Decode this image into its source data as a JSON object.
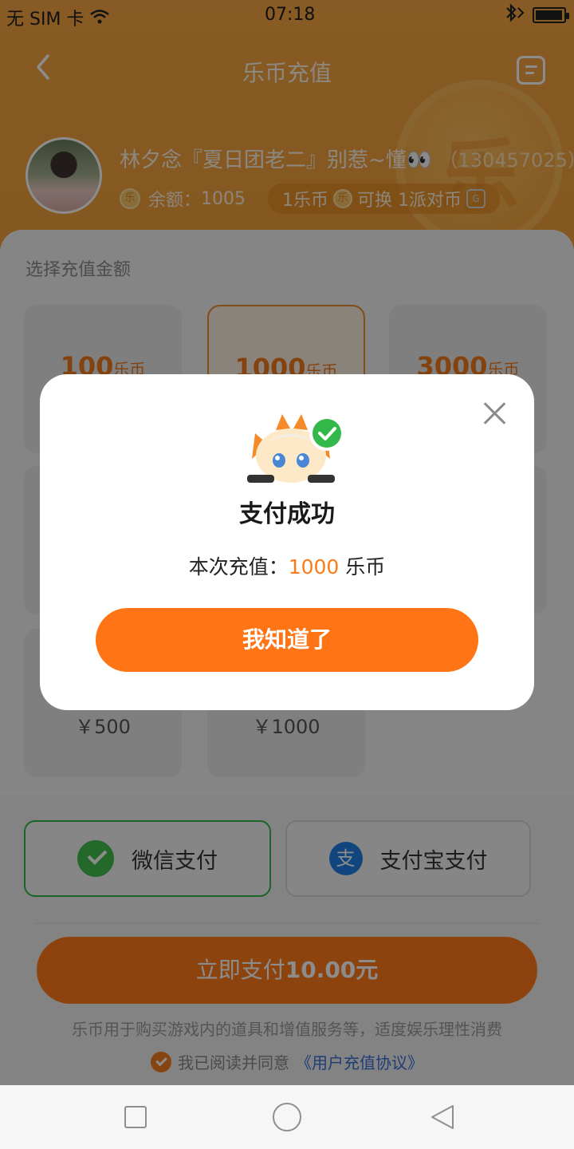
{
  "status_bar": {
    "carrier": "无 SIM 卡",
    "time": "07:18"
  },
  "nav": {
    "title": "乐币充值"
  },
  "user": {
    "name": "林夕念『夏日团老二』别惹~懂👀",
    "id": "（130457025）",
    "balance_label": "余额：",
    "balance": "1005",
    "rate_part1": "1乐币",
    "rate_part2": "可换 1派对币"
  },
  "recharge": {
    "section_title": "选择充值金额",
    "unit": "乐币",
    "options": [
      {
        "amount": "100",
        "price": ""
      },
      {
        "amount": "1000",
        "price": ""
      },
      {
        "amount": "3000",
        "price": ""
      },
      {
        "amount": "",
        "price": ""
      },
      {
        "amount": "",
        "price": ""
      },
      {
        "amount": "",
        "price": ""
      },
      {
        "amount": "",
        "price": "￥500"
      },
      {
        "amount": "",
        "price": "￥1000"
      }
    ]
  },
  "payment": {
    "wechat_label": "微信支付",
    "alipay_label": "支付宝支付",
    "pay_now_prefix": "立即支付",
    "pay_now_amount": "10.00元",
    "notice": "乐币用于购买游戏内的道具和增值服务等，适度娱乐理性消费",
    "agree_text": "我已阅读并同意",
    "agree_link": "《用户充值协议》"
  },
  "modal": {
    "title": "支付成功",
    "text_prefix": "本次充值：",
    "amount": "1000",
    "text_suffix": " 乐币",
    "confirm_label": "我知道了"
  },
  "icons": {
    "back": "chevron-left-icon",
    "menu": "document-list-icon",
    "close": "close-icon",
    "wechat": "wechat-pay-icon",
    "alipay": "alipay-icon"
  },
  "colors": {
    "accent": "#ff7a1a",
    "header": "#f4a23e",
    "wechat": "#3fbf4e",
    "alipay": "#1e7ee3"
  }
}
